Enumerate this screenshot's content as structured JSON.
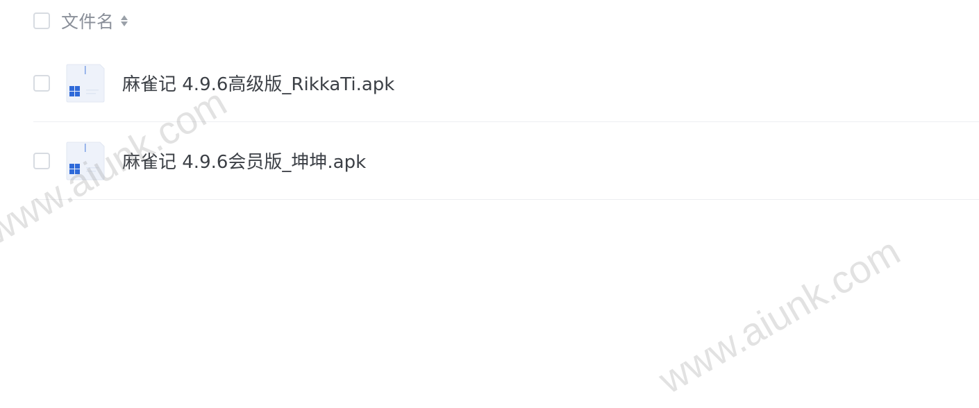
{
  "header": {
    "column_label": "文件名"
  },
  "files": [
    {
      "name": "麻雀记 4.9.6高级版_RikkaTi.apk",
      "icon": "apk-file-icon"
    },
    {
      "name": "麻雀记 4.9.6会员版_坤坤.apk",
      "icon": "apk-file-icon"
    }
  ],
  "watermark": "www.aiunk.com",
  "colors": {
    "checkbox_border": "#d7dbe1",
    "header_text": "#8a8f99",
    "file_text": "#3c4046",
    "divider": "#eceef1",
    "icon_accent": "#2f6ad9"
  }
}
